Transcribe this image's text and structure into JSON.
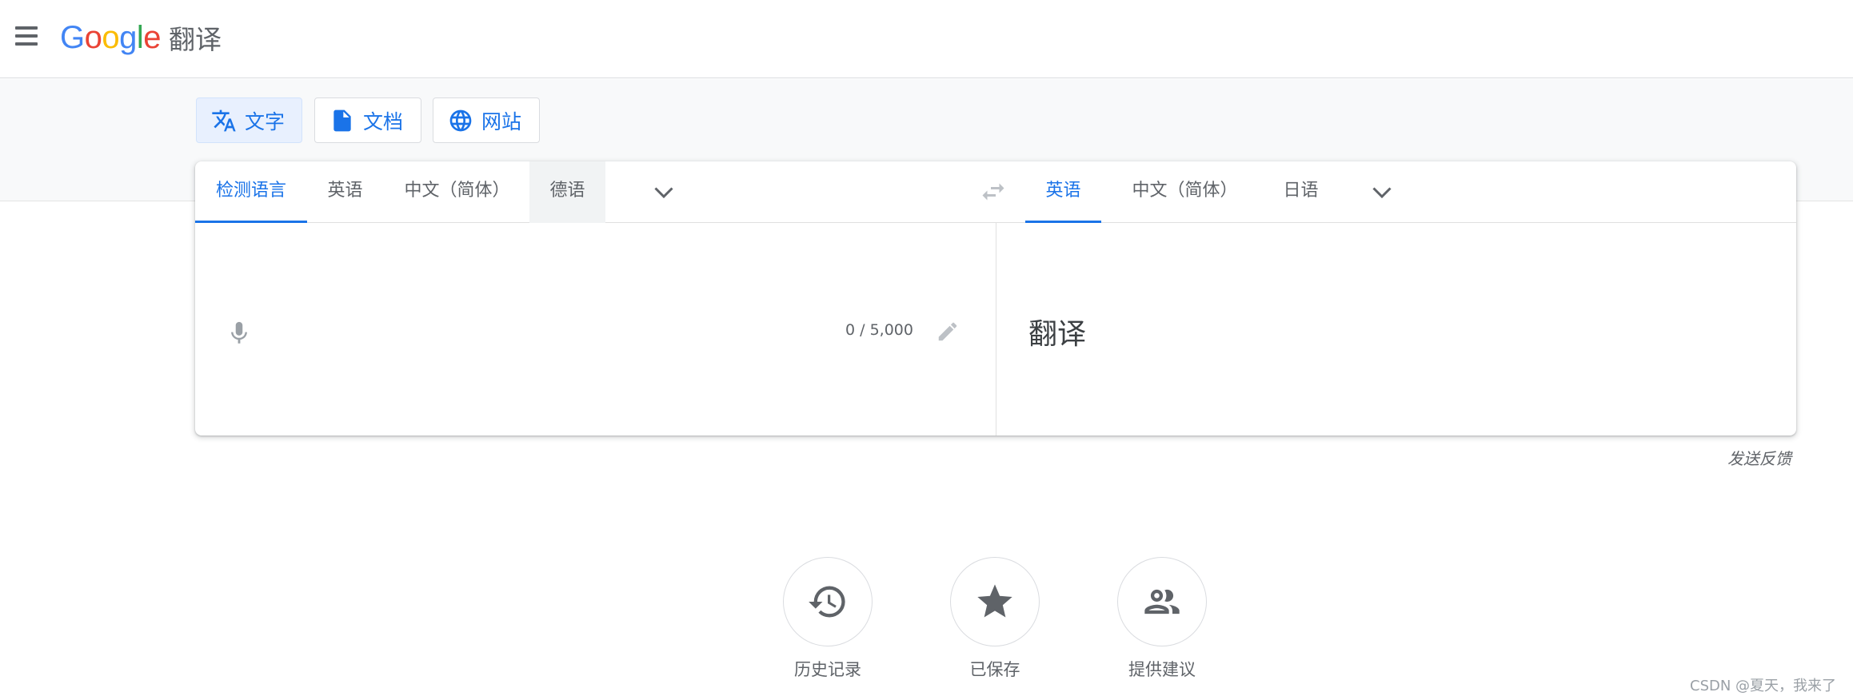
{
  "header": {
    "logo_letters": [
      "G",
      "o",
      "o",
      "g",
      "l",
      "e"
    ],
    "product": "翻译"
  },
  "colors": {
    "accent": "#1a73e8",
    "logo": [
      "#4285F4",
      "#EA4335",
      "#FBBC05",
      "#4285F4",
      "#34A853",
      "#EA4335"
    ]
  },
  "modes": [
    {
      "label": "文字",
      "icon": "translate-icon",
      "active": true
    },
    {
      "label": "文档",
      "icon": "document-icon"
    },
    {
      "label": "网站",
      "icon": "globe-icon"
    }
  ],
  "source_langs": [
    "检测语言",
    "英语",
    "中文（简体）",
    "德语"
  ],
  "target_langs": [
    "英语",
    "中文（简体）",
    "日语"
  ],
  "input": {
    "value": "",
    "char_count": "0 / 5,000"
  },
  "output": {
    "text": "翻译"
  },
  "feedback": "发送反馈",
  "actions": [
    {
      "label": "历史记录",
      "icon": "history-icon"
    },
    {
      "label": "已保存",
      "icon": "star-icon"
    },
    {
      "label": "提供建议",
      "icon": "people-icon"
    }
  ],
  "watermark": "CSDN @夏天，我来了"
}
